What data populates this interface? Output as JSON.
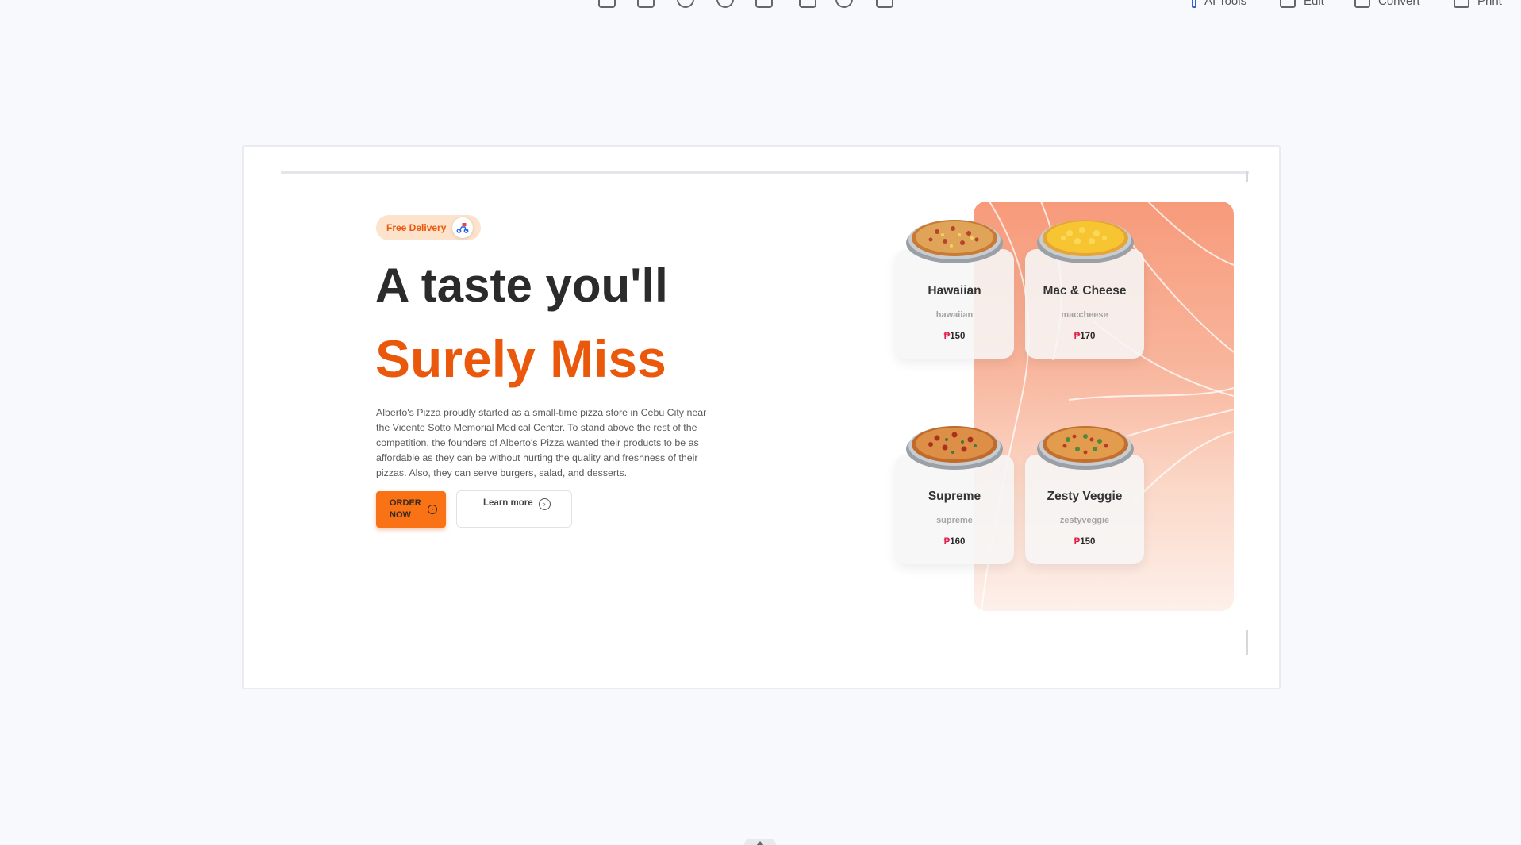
{
  "toolbar": {
    "ai_tools_label": "AI Tools",
    "edit_label": "Edit",
    "convert_label": "Convert",
    "print_label": "Print"
  },
  "hero": {
    "badge_label": "Free Delivery",
    "title_line1": "A taste you'll",
    "title_line2": "Surely Miss",
    "description": "Alberto's Pizza proudly started as a small-time pizza store in Cebu City near the Vicente Sotto Memorial Medical Center. To stand above the rest of the competition, the founders of Alberto's Pizza wanted their products to be as affordable as they can be without hurting the quality and freshness of their pizzas. Also, they can serve burgers, salad, and desserts.",
    "order_button": "ORDER NOW",
    "learn_button": "Learn more"
  },
  "currency": "₱",
  "pizzas": [
    {
      "name": "Hawaiian",
      "slug": "hawaiian",
      "price": "150"
    },
    {
      "name": "Mac & Cheese",
      "slug": "maccheese",
      "price": "170"
    },
    {
      "name": "Supreme",
      "slug": "supreme",
      "price": "160"
    },
    {
      "name": "Zesty Veggie",
      "slug": "zestyveggie",
      "price": "150"
    }
  ],
  "colors": {
    "accent": "#ea580c",
    "button": "#f97316",
    "price_symbol": "#e11d48",
    "panel_top": "#f79a7a"
  }
}
